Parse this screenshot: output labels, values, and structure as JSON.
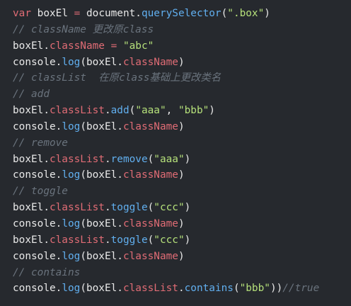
{
  "editor": {
    "background": "#26292e",
    "lines": [
      {
        "type": "code",
        "tokens": [
          {
            "t": "var",
            "c": "kw"
          },
          {
            "t": " boxEl ",
            "c": "var"
          },
          {
            "t": "=",
            "c": "op"
          },
          {
            "t": " document.",
            "c": "var"
          },
          {
            "t": "querySelector",
            "c": "fn"
          },
          {
            "t": "(",
            "c": "punc"
          },
          {
            "t": "\".box\"",
            "c": "str"
          },
          {
            "t": ")",
            "c": "punc"
          }
        ]
      },
      {
        "type": "comment",
        "tokens": [
          {
            "t": "// className 更改原class",
            "c": "com"
          }
        ]
      },
      {
        "type": "code",
        "tokens": [
          {
            "t": "boxEl.",
            "c": "var"
          },
          {
            "t": "className",
            "c": "prop"
          },
          {
            "t": " = ",
            "c": "op"
          },
          {
            "t": "\"abc\"",
            "c": "str"
          }
        ]
      },
      {
        "type": "code",
        "tokens": [
          {
            "t": "console.",
            "c": "var"
          },
          {
            "t": "log",
            "c": "fn"
          },
          {
            "t": "(boxEl.",
            "c": "punc"
          },
          {
            "t": "className",
            "c": "prop"
          },
          {
            "t": ")",
            "c": "punc"
          }
        ]
      },
      {
        "type": "comment",
        "tokens": [
          {
            "t": "// classList  在原class基础上更改类名",
            "c": "com"
          }
        ]
      },
      {
        "type": "comment",
        "tokens": [
          {
            "t": "// add",
            "c": "com"
          }
        ]
      },
      {
        "type": "code",
        "tokens": [
          {
            "t": "boxEl.",
            "c": "var"
          },
          {
            "t": "classList",
            "c": "prop"
          },
          {
            "t": ".",
            "c": "punc"
          },
          {
            "t": "add",
            "c": "fn"
          },
          {
            "t": "(",
            "c": "punc"
          },
          {
            "t": "\"aaa\"",
            "c": "str"
          },
          {
            "t": ", ",
            "c": "punc"
          },
          {
            "t": "\"bbb\"",
            "c": "str"
          },
          {
            "t": ")",
            "c": "punc"
          }
        ]
      },
      {
        "type": "code",
        "tokens": [
          {
            "t": "console.",
            "c": "var"
          },
          {
            "t": "log",
            "c": "fn"
          },
          {
            "t": "(boxEl.",
            "c": "punc"
          },
          {
            "t": "className",
            "c": "prop"
          },
          {
            "t": ")",
            "c": "punc"
          }
        ]
      },
      {
        "type": "comment",
        "tokens": [
          {
            "t": "// remove",
            "c": "com"
          }
        ]
      },
      {
        "type": "code",
        "tokens": [
          {
            "t": "boxEl.",
            "c": "var"
          },
          {
            "t": "classList",
            "c": "prop"
          },
          {
            "t": ".",
            "c": "punc"
          },
          {
            "t": "remove",
            "c": "fn"
          },
          {
            "t": "(",
            "c": "punc"
          },
          {
            "t": "\"aaa\"",
            "c": "str"
          },
          {
            "t": ")",
            "c": "punc"
          }
        ]
      },
      {
        "type": "code",
        "tokens": [
          {
            "t": "console.",
            "c": "var"
          },
          {
            "t": "log",
            "c": "fn"
          },
          {
            "t": "(boxEl.",
            "c": "punc"
          },
          {
            "t": "className",
            "c": "prop"
          },
          {
            "t": ")",
            "c": "punc"
          }
        ]
      },
      {
        "type": "comment",
        "tokens": [
          {
            "t": "// toggle",
            "c": "com"
          }
        ]
      },
      {
        "type": "code",
        "tokens": [
          {
            "t": "boxEl.",
            "c": "var"
          },
          {
            "t": "classList",
            "c": "prop"
          },
          {
            "t": ".",
            "c": "punc"
          },
          {
            "t": "toggle",
            "c": "fn"
          },
          {
            "t": "(",
            "c": "punc"
          },
          {
            "t": "\"ccc\"",
            "c": "str"
          },
          {
            "t": ")",
            "c": "punc"
          }
        ]
      },
      {
        "type": "code",
        "tokens": [
          {
            "t": "console.",
            "c": "var"
          },
          {
            "t": "log",
            "c": "fn"
          },
          {
            "t": "(boxEl.",
            "c": "punc"
          },
          {
            "t": "className",
            "c": "prop"
          },
          {
            "t": ")",
            "c": "punc"
          }
        ]
      },
      {
        "type": "code",
        "tokens": [
          {
            "t": "boxEl.",
            "c": "var"
          },
          {
            "t": "classList",
            "c": "prop"
          },
          {
            "t": ".",
            "c": "punc"
          },
          {
            "t": "toggle",
            "c": "fn"
          },
          {
            "t": "(",
            "c": "punc"
          },
          {
            "t": "\"ccc\"",
            "c": "str"
          },
          {
            "t": ")",
            "c": "punc"
          }
        ]
      },
      {
        "type": "code",
        "tokens": [
          {
            "t": "console.",
            "c": "var"
          },
          {
            "t": "log",
            "c": "fn"
          },
          {
            "t": "(boxEl.",
            "c": "punc"
          },
          {
            "t": "className",
            "c": "prop"
          },
          {
            "t": ")",
            "c": "punc"
          }
        ]
      },
      {
        "type": "comment",
        "tokens": [
          {
            "t": "// contains",
            "c": "com"
          }
        ]
      },
      {
        "type": "code",
        "tokens": [
          {
            "t": "console.",
            "c": "var"
          },
          {
            "t": "log",
            "c": "fn"
          },
          {
            "t": "(boxEl.",
            "c": "punc"
          },
          {
            "t": "classList",
            "c": "prop"
          },
          {
            "t": ".",
            "c": "punc"
          },
          {
            "t": "contains",
            "c": "fn"
          },
          {
            "t": "(",
            "c": "punc"
          },
          {
            "t": "\"bbb\"",
            "c": "str"
          },
          {
            "t": "))",
            "c": "punc"
          },
          {
            "t": "//true",
            "c": "bool"
          }
        ]
      }
    ]
  }
}
